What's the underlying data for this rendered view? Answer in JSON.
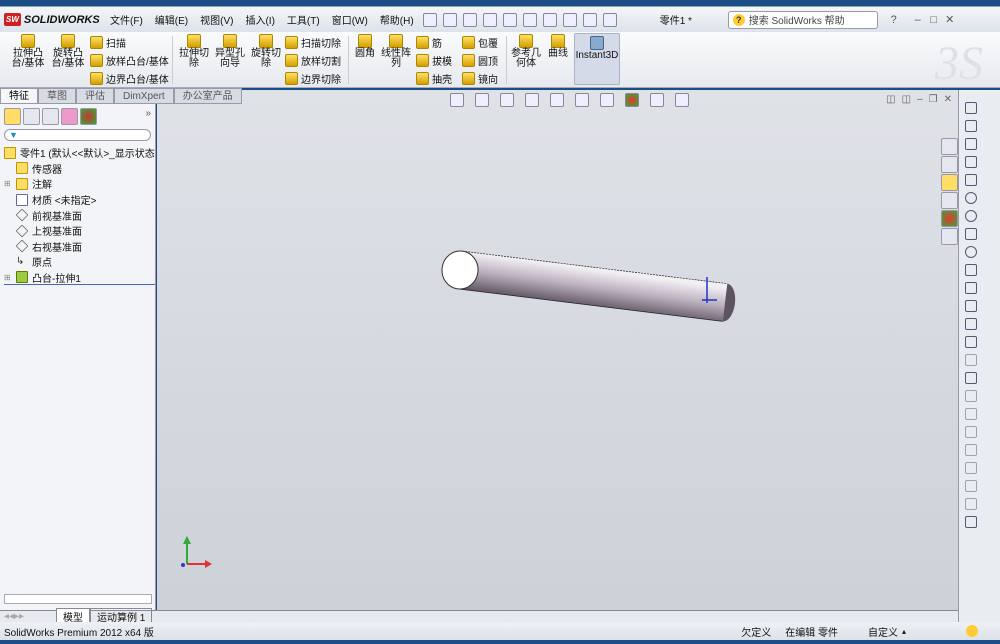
{
  "app": {
    "logo": "SOLIDWORKS",
    "doc_title": "零件1 *"
  },
  "menu": [
    "文件(F)",
    "编辑(E)",
    "视图(V)",
    "插入(I)",
    "工具(T)",
    "窗口(W)",
    "帮助(H)"
  ],
  "search": {
    "placeholder": "搜索 SolidWorks 帮助"
  },
  "ribbon": {
    "extrude_boss": "拉伸凸台/基体",
    "revolve_boss": "旋转凸台/基体",
    "sweep": "扫描",
    "loft": "放样凸台/基体",
    "boundary_boss": "边界凸台/基体",
    "extrude_cut": "拉伸切除",
    "hole_wizard": "异型孔向导",
    "revolve_cut": "旋转切除",
    "sweep_cut": "扫描切除",
    "loft_cut": "放样切割",
    "boundary_cut": "边界切除",
    "fillet": "圆角",
    "linear_pattern": "线性阵列",
    "rib": "筋",
    "draft": "拔模",
    "shell": "抽壳",
    "wrap": "包覆",
    "dome": "圆顶",
    "mirror": "镜向",
    "ref_geometry": "参考几何体",
    "curves": "曲线",
    "instant3d": "Instant3D"
  },
  "tabs": [
    "特征",
    "草图",
    "评估",
    "DimXpert",
    "办公室产品"
  ],
  "tree": {
    "root": "零件1 (默认<<默认>_显示状态",
    "items": [
      "传感器",
      "注解",
      "材质 <未指定>",
      "前视基准面",
      "上视基准面",
      "右视基准面",
      "原点",
      "凸台-拉伸1"
    ]
  },
  "bottom_tabs": [
    "模型",
    "运动算例 1"
  ],
  "status": {
    "version": "SolidWorks Premium 2012 x64 版",
    "state": "欠定义",
    "mode": "在编辑 零件",
    "custom": "自定义"
  }
}
